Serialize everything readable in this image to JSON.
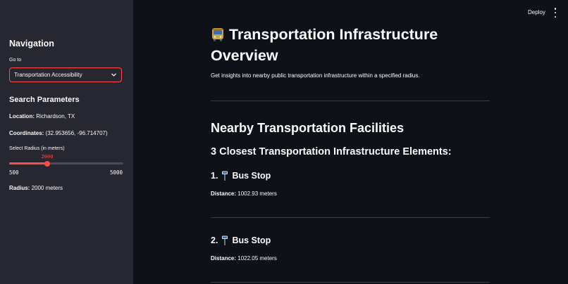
{
  "topbar": {
    "deploy_label": "Deploy"
  },
  "sidebar": {
    "nav_title": "Navigation",
    "goto_label": "Go to",
    "goto_value": "Transportation Accessibility",
    "search_title": "Search Parameters",
    "location_label": "Location:",
    "location_value": " Richardson, TX",
    "coordinates_label": "Coordinates:",
    "coordinates_value": " (32.953656, -96.714707)",
    "slider_label": "Select Radius (in meters)",
    "slider": {
      "value": 2000,
      "min": 500,
      "max": 5000,
      "value_text": "2000",
      "min_text": "500",
      "max_text": "5000"
    },
    "radius_label": "Radius:",
    "radius_value": " 2000 meters"
  },
  "main": {
    "title": "Transportation Infrastructure Overview",
    "description": "Get insights into nearby public transportation infrastructure within a specified radius.",
    "section_title": "Nearby Transportation Facilities",
    "subsection_title": "3 Closest Transportation Infrastructure Elements:",
    "items": [
      {
        "index": "1.",
        "name": "Bus Stop",
        "distance_label": "Distance:",
        "distance_value": " 1002.93 meters"
      },
      {
        "index": "2.",
        "name": "Bus Stop",
        "distance_label": "Distance:",
        "distance_value": " 1022.05 meters"
      }
    ]
  },
  "colors": {
    "accent": "#ff4b4b",
    "sidebar_bg": "#262730",
    "main_bg": "#0e1117"
  }
}
